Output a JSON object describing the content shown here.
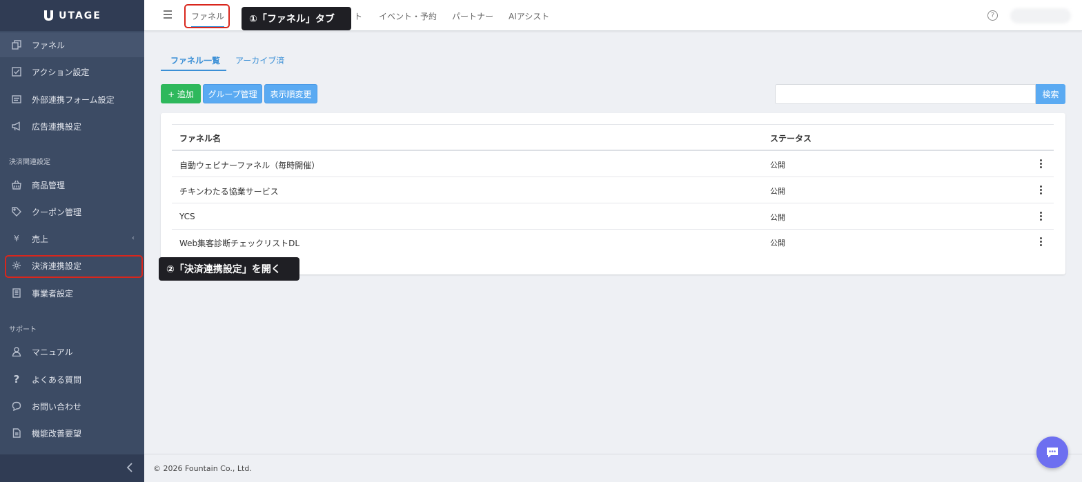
{
  "brand": {
    "name": "UTAGE"
  },
  "sidebar": {
    "items": [
      {
        "label": "ファネル",
        "icon": "copy-icon"
      },
      {
        "label": "アクション設定",
        "icon": "checklist-icon"
      },
      {
        "label": "外部連携フォーム設定",
        "icon": "form-icon"
      },
      {
        "label": "広告連携設定",
        "icon": "megaphone-icon"
      }
    ],
    "section_payment": "決済関連設定",
    "payment_items": [
      {
        "label": "商品管理",
        "icon": "basket-icon"
      },
      {
        "label": "クーポン管理",
        "icon": "tag-icon"
      },
      {
        "label": "売上",
        "icon": "yen-icon",
        "glyph": "¥"
      },
      {
        "label": "決済連携設定",
        "icon": "gear-icon"
      },
      {
        "label": "事業者設定",
        "icon": "building-icon"
      }
    ],
    "section_support": "サポート",
    "support_items": [
      {
        "label": "マニュアル",
        "icon": "person-icon"
      },
      {
        "label": "よくある質問",
        "icon": "question-icon",
        "glyph": "?"
      },
      {
        "label": "お問い合わせ",
        "icon": "chat-icon"
      },
      {
        "label": "機能改善要望",
        "icon": "document-icon"
      }
    ]
  },
  "header": {
    "tabs": [
      {
        "label": "ファネル"
      },
      {
        "label": "ト"
      },
      {
        "label": "イベント・予約"
      },
      {
        "label": "パートナー"
      },
      {
        "label": "AIアシスト"
      }
    ],
    "help_glyph": "?"
  },
  "callouts": {
    "one": "①「ファネル」タブ",
    "two": "②「決済連携設定」を開く"
  },
  "main": {
    "subtabs": [
      {
        "label": "ファネル一覧"
      },
      {
        "label": "アーカイブ済"
      }
    ],
    "buttons": {
      "add": "+ 追加",
      "group": "グループ管理",
      "order": "表示順変更"
    },
    "search": {
      "placeholder": "",
      "button": "検索"
    },
    "table": {
      "headers": {
        "name": "ファネル名",
        "status": "ステータス"
      },
      "rows": [
        {
          "name": "自動ウェビナーファネル（毎時開催）",
          "status": "公開"
        },
        {
          "name": "チキンわたる協業サービス",
          "status": "公開"
        },
        {
          "name": "YCS",
          "status": "公開"
        },
        {
          "name": "Web集客診断チェックリストDL",
          "status": "公開"
        }
      ]
    }
  },
  "footer": {
    "copyright": "© 2026 Fountain Co., Ltd."
  },
  "colors": {
    "sidebar": "#3c4b64",
    "accent": "#3a8fd6",
    "add": "#2eb85c",
    "highlight": "#d9261c",
    "chat": "#6d6ff0"
  }
}
